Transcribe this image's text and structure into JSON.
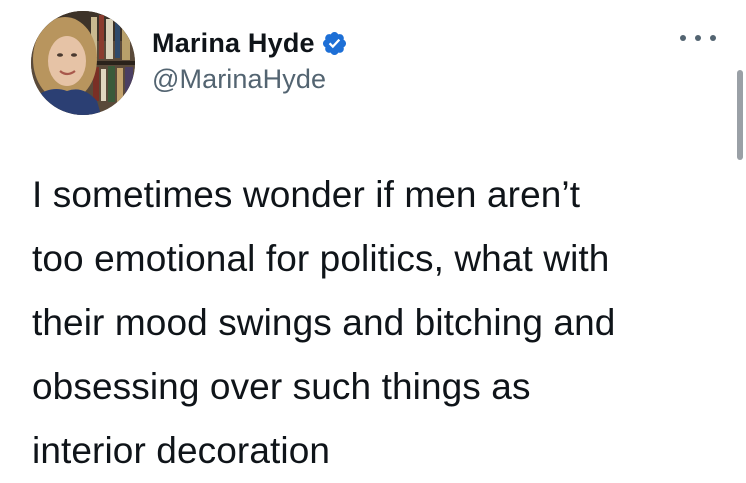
{
  "tweet": {
    "author": {
      "display_name": "Marina Hyde",
      "handle": "@MarinaHyde",
      "verified": true,
      "verified_badge_color": "#1d6fd6"
    },
    "text": "I sometimes wonder if men aren’t\ntoo emotional for politics, what with\ntheir mood swings and bitching and\nobsessing over such things as\ninterior decoration",
    "more_menu_icon": "ellipsis-icon"
  },
  "colors": {
    "text_primary": "#0f1419",
    "text_secondary": "#536471",
    "background": "#ffffff"
  }
}
